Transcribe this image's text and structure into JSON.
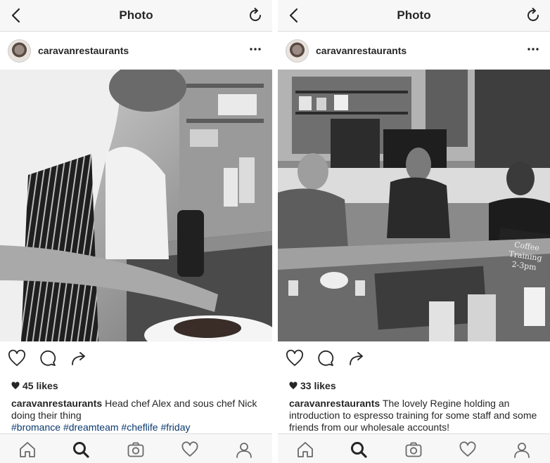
{
  "screens": [
    {
      "nav": {
        "title": "Photo"
      },
      "post": {
        "username": "caravanrestaurants",
        "likes": "45 likes",
        "caption_user": "caravanrestaurants",
        "caption_text": " Head chef Alex and sous chef Nick doing their thing",
        "hashtags": [
          "#bromance",
          "#dreamteam",
          "#cheflife",
          "#friday"
        ],
        "photo_subject": "chefs-plating-food"
      }
    },
    {
      "nav": {
        "title": "Photo"
      },
      "post": {
        "username": "caravanrestaurants",
        "likes": "33 likes",
        "caption_user": "caravanrestaurants",
        "caption_text": " The lovely Regine holding an introduction to espresso training for some staff and some friends from our wholesale accounts!",
        "chalkboard_text": [
          "Coffee",
          "Training",
          "2-3pm"
        ],
        "photo_subject": "espresso-training-session"
      }
    }
  ],
  "icons": {
    "nav": [
      "chevron-left-icon",
      "refresh-icon"
    ],
    "post": [
      "more-options-icon",
      "heart-icon",
      "comment-icon",
      "share-icon"
    ],
    "tabs": [
      "home-icon",
      "search-icon",
      "camera-icon",
      "activity-heart-icon",
      "profile-icon"
    ]
  },
  "colors": {
    "hashtag": "#0b3a6e",
    "bar_bg": "#f7f7f7",
    "text": "#262626"
  }
}
